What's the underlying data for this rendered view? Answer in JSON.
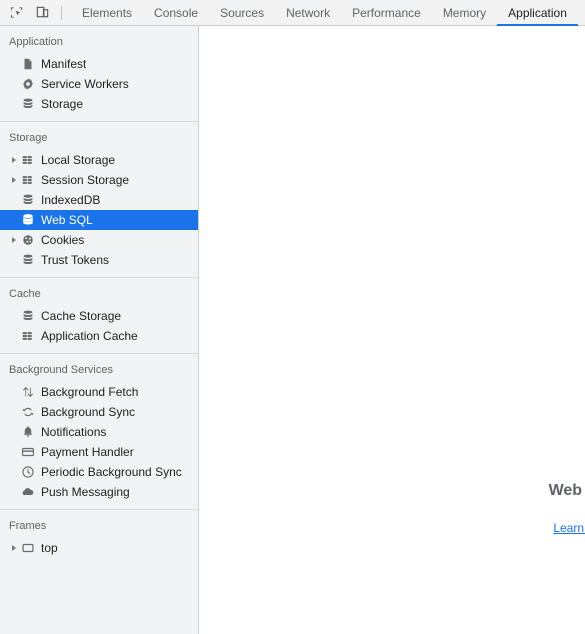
{
  "toolbar": {
    "buttons": [
      {
        "name": "inspect-element-icon",
        "title": "Inspect element"
      },
      {
        "name": "device-toolbar-icon",
        "title": "Toggle device toolbar"
      }
    ],
    "tabs": [
      {
        "label": "Elements",
        "active": false
      },
      {
        "label": "Console",
        "active": false
      },
      {
        "label": "Sources",
        "active": false
      },
      {
        "label": "Network",
        "active": false
      },
      {
        "label": "Performance",
        "active": false
      },
      {
        "label": "Memory",
        "active": false
      },
      {
        "label": "Application",
        "active": true
      }
    ]
  },
  "sidebar": {
    "sections": [
      {
        "title": "Application",
        "items": [
          {
            "label": "Manifest",
            "icon": "manifest-icon",
            "twisty": false,
            "selected": false
          },
          {
            "label": "Service Workers",
            "icon": "gear-icon",
            "twisty": false,
            "selected": false
          },
          {
            "label": "Storage",
            "icon": "database-icon",
            "twisty": false,
            "selected": false
          }
        ]
      },
      {
        "title": "Storage",
        "items": [
          {
            "label": "Local Storage",
            "icon": "table-icon",
            "twisty": true,
            "selected": false
          },
          {
            "label": "Session Storage",
            "icon": "table-icon",
            "twisty": true,
            "selected": false
          },
          {
            "label": "IndexedDB",
            "icon": "database-icon",
            "twisty": false,
            "selected": false
          },
          {
            "label": "Web SQL",
            "icon": "database-icon",
            "twisty": false,
            "selected": true
          },
          {
            "label": "Cookies",
            "icon": "cookie-icon",
            "twisty": true,
            "selected": false
          },
          {
            "label": "Trust Tokens",
            "icon": "database-icon",
            "twisty": false,
            "selected": false
          }
        ]
      },
      {
        "title": "Cache",
        "items": [
          {
            "label": "Cache Storage",
            "icon": "database-icon",
            "twisty": false,
            "selected": false
          },
          {
            "label": "Application Cache",
            "icon": "table-icon",
            "twisty": false,
            "selected": false
          }
        ]
      },
      {
        "title": "Background Services",
        "items": [
          {
            "label": "Background Fetch",
            "icon": "arrows-updown-icon",
            "twisty": false,
            "selected": false
          },
          {
            "label": "Background Sync",
            "icon": "sync-icon",
            "twisty": false,
            "selected": false
          },
          {
            "label": "Notifications",
            "icon": "bell-icon",
            "twisty": false,
            "selected": false
          },
          {
            "label": "Payment Handler",
            "icon": "credit-card-icon",
            "twisty": false,
            "selected": false
          },
          {
            "label": "Periodic Background Sync",
            "icon": "clock-icon",
            "twisty": false,
            "selected": false
          },
          {
            "label": "Push Messaging",
            "icon": "cloud-icon",
            "twisty": false,
            "selected": false
          }
        ]
      },
      {
        "title": "Frames",
        "items": [
          {
            "label": "top",
            "icon": "frame-icon",
            "twisty": true,
            "selected": false
          }
        ]
      }
    ]
  },
  "main": {
    "empty_state_title": "Web SQL",
    "empty_state_link": "Learn more"
  },
  "colors": {
    "accent": "#1a73e8",
    "sidebar_bg": "#f1f3f4",
    "toolbar_bg": "#f3f3f3",
    "text": "#202124",
    "muted_text": "#5f6368"
  }
}
